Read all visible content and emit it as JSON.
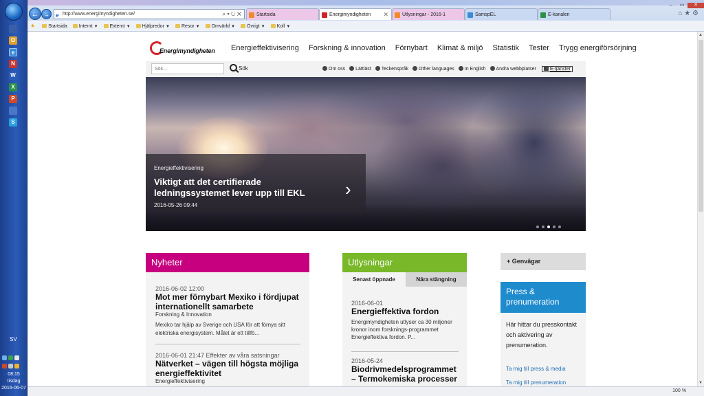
{
  "taskbar": {
    "language": "SV",
    "clock_time": "08:15",
    "clock_day": "tisdag",
    "clock_date": "2016-06-07",
    "apps": [
      {
        "glyph": "",
        "color": "#3a5fa8"
      },
      {
        "glyph": "O",
        "color": "#e0a02a"
      },
      {
        "glyph": "e",
        "color": "#3a8ad6"
      },
      {
        "glyph": "N",
        "color": "#c8352e"
      },
      {
        "glyph": "W",
        "color": "#2a5cb8"
      },
      {
        "glyph": "X",
        "color": "#2a9146"
      },
      {
        "glyph": "P",
        "color": "#d24726"
      },
      {
        "glyph": "",
        "color": "#4a78c8"
      },
      {
        "glyph": "S",
        "color": "#2aa0e0"
      }
    ]
  },
  "browser": {
    "url": "http://www.energimyndigheten.se/",
    "address_tools": "⌕ ▾ ↻ ✕",
    "tabs": [
      {
        "label": "Startsida",
        "color": "#f08a2a",
        "bg": "#ecc7e8",
        "active": false
      },
      {
        "label": "Energimyndigheten",
        "color": "#d3232a",
        "bg": "#ffffff",
        "active": true
      },
      {
        "label": "Utlysningar - 2016-1",
        "color": "#f08a2a",
        "bg": "#ecc7e8",
        "active": false
      },
      {
        "label": "SamspEL",
        "color": "#3a8ad6",
        "bg": "#c9d9f2",
        "active": false
      },
      {
        "label": "E-kanalen",
        "color": "#2a9146",
        "bg": "#c9d9f2",
        "active": false
      }
    ],
    "favorites": [
      {
        "label": "Startsida",
        "menu": false
      },
      {
        "label": "Internt",
        "menu": true
      },
      {
        "label": "Externt",
        "menu": true
      },
      {
        "label": "Hjälpredor",
        "menu": true
      },
      {
        "label": "Resor",
        "menu": true
      },
      {
        "label": "Omvärld",
        "menu": true
      },
      {
        "label": "Övrigt",
        "menu": true
      },
      {
        "label": "Koll",
        "menu": true
      }
    ],
    "zoom": "100 %"
  },
  "site": {
    "logo_text": "Energimyndigheten",
    "nav": [
      "Energieffektivisering",
      "Forskning & innovation",
      "Förnybart",
      "Klimat & miljö",
      "Statistik",
      "Tester",
      "Trygg energiförsörjning"
    ],
    "search_placeholder": "Sök...",
    "search_button": "Sök",
    "utility_links": [
      "Om oss",
      "Lättläst",
      "Teckenspråk",
      "Other languages",
      "In English",
      "Andra webbplatser"
    ],
    "etjanster": "E-tjänster",
    "hero": {
      "category": "Energieffektivisering",
      "title": "Viktigt att det certifierade ledningssystemet lever upp till EKL",
      "date": "2016-05-26 09:44",
      "slide_current": 3,
      "slide_total": 5
    },
    "nyheter": {
      "heading": "Nyheter",
      "items": [
        {
          "date": "2016-06-02 12:00",
          "title": "Mot mer förnybart Mexiko i fördjupat internationellt samarbete",
          "category": "Forskning & Innovation",
          "desc": "Mexiko tar hjälp av Sverige och USA för att förnya sitt elektriska energisystem. Målet är ett tillfö..."
        },
        {
          "date": "2016-06-01 21:47 Effekter av våra satsningar",
          "title": "Nätverket – vägen till högsta möjliga energieffektivitet",
          "category": "Energieffektivisering",
          "desc": ""
        }
      ]
    },
    "utlysningar": {
      "heading": "Utlysningar",
      "tab_recent": "Senast öppnade",
      "tab_closing": "Nära stängning",
      "items": [
        {
          "date": "2016-06-01",
          "title": "Energieffektiva fordon",
          "desc": "Energimyndigheten utlyser ca 30 miljoner kronor inom forsknings-programmet Energieffektiva fordon. P..."
        },
        {
          "date": "2016-05-24",
          "title": "Biodrivmedelsprogrammet – Termokemiska processer",
          "desc": ""
        }
      ]
    },
    "genvagar": "Genvägar",
    "press": {
      "heading": "Press & prenumeration",
      "desc": "Här hittar du presskontakt och aktivering av prenumeration.",
      "link1": "Ta mig till press & media",
      "link2": "Ta mig till prenumeration"
    }
  }
}
